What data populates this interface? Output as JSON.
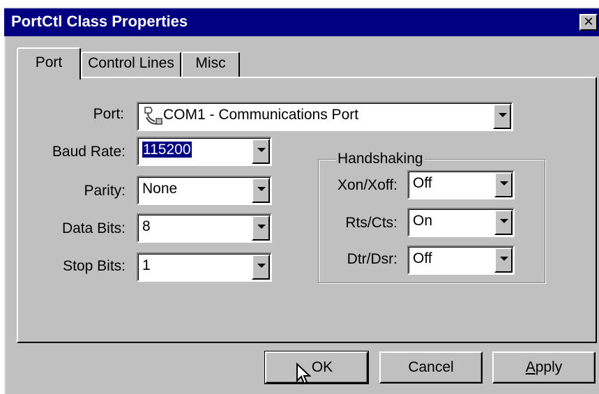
{
  "window": {
    "title": "PortCtl Class Properties",
    "close_glyph": "✕"
  },
  "tabs": [
    {
      "label": "Port",
      "selected": true
    },
    {
      "label": "Control Lines"
    },
    {
      "label": "Misc"
    }
  ],
  "port": {
    "label": "Port:",
    "value": "COM1 - Communications Port",
    "icon": "port-connector-icon"
  },
  "baud_rate": {
    "label": "Baud Rate:",
    "value": "115200"
  },
  "parity": {
    "label": "Parity:",
    "value": "None"
  },
  "data_bits": {
    "label": "Data Bits:",
    "value": "8"
  },
  "stop_bits": {
    "label": "Stop Bits:",
    "value": "1"
  },
  "handshaking": {
    "title": "Handshaking",
    "xon_xoff": {
      "label": "Xon/Xoff:",
      "value": "Off"
    },
    "rts_cts": {
      "label": "Rts/Cts:",
      "value": "On"
    },
    "dtr_dsr": {
      "label": "Dtr/Dsr:",
      "value": "Off"
    }
  },
  "buttons": {
    "ok": "OK",
    "cancel": "Cancel",
    "apply_prefix": "",
    "apply_underlined": "A",
    "apply_rest": "pply"
  },
  "colors": {
    "titlebar": "#000080",
    "face": "#c0c0c0",
    "selection": "#000080"
  }
}
